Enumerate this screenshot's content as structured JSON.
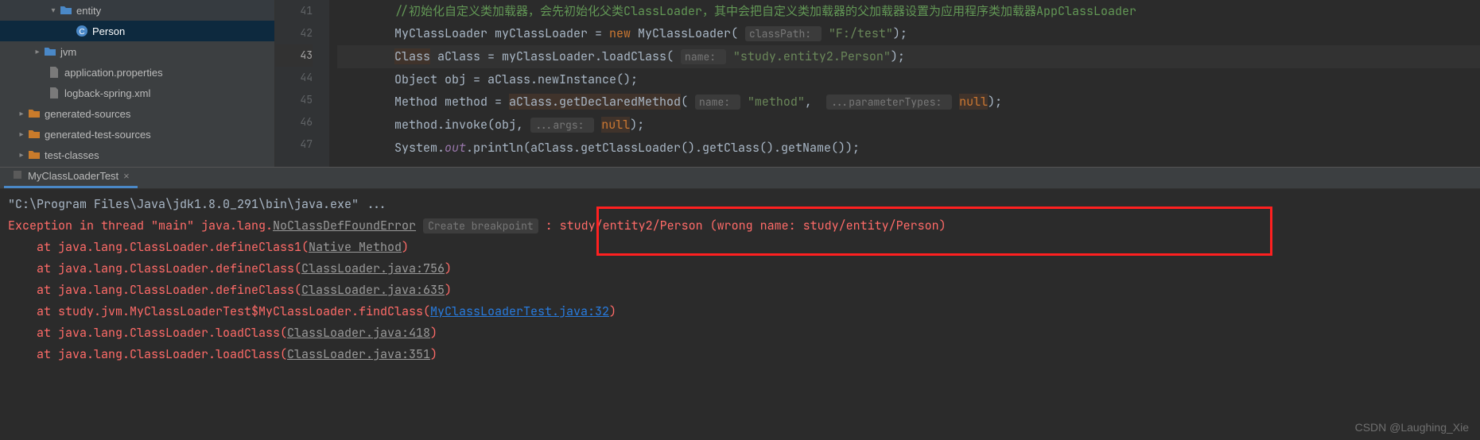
{
  "tree": {
    "items": [
      {
        "indent": 55,
        "chev": "▾",
        "icon": "folder-blue",
        "label": "entity"
      },
      {
        "indent": 75,
        "chev": "",
        "icon": "class",
        "label": "Person",
        "selected": true
      },
      {
        "indent": 35,
        "chev": "▸",
        "icon": "folder-blue",
        "label": "jvm"
      },
      {
        "indent": 40,
        "chev": "",
        "icon": "file",
        "label": "application.properties"
      },
      {
        "indent": 40,
        "chev": "",
        "icon": "file",
        "label": "logback-spring.xml"
      },
      {
        "indent": 15,
        "chev": "▸",
        "icon": "folder-orange",
        "label": "generated-sources"
      },
      {
        "indent": 15,
        "chev": "▸",
        "icon": "folder-orange",
        "label": "generated-test-sources"
      },
      {
        "indent": 15,
        "chev": "▸",
        "icon": "folder-orange",
        "label": "test-classes"
      }
    ]
  },
  "editor": {
    "lines": [
      {
        "n": 41,
        "tokens": [
          {
            "t": "        ",
            "c": ""
          },
          {
            "t": "//初始化自定义类加载器，会先初始化父类ClassLoader，其中会把自定义类加载器的父加载器设置为应用程序类加载器AppClassLoader",
            "c": "c-comment"
          }
        ]
      },
      {
        "n": 42,
        "tokens": [
          {
            "t": "        MyClassLoader myClassLoader = ",
            "c": ""
          },
          {
            "t": "new ",
            "c": "c-keyword"
          },
          {
            "t": "MyClassLoader( ",
            "c": ""
          },
          {
            "t": "classPath: ",
            "c": "c-paramhint"
          },
          {
            "t": " ",
            "c": ""
          },
          {
            "t": "\"F:/test\"",
            "c": "c-string"
          },
          {
            "t": ");",
            "c": ""
          }
        ]
      },
      {
        "n": 43,
        "cur": true,
        "tokens": [
          {
            "t": "        ",
            "c": ""
          },
          {
            "t": "Class",
            "c": "c-hl"
          },
          {
            "t": " aClass = myClassLoader.loadClass( ",
            "c": ""
          },
          {
            "t": "name: ",
            "c": "c-paramhint"
          },
          {
            "t": " ",
            "c": ""
          },
          {
            "t": "\"study.entity2.Person\"",
            "c": "c-string"
          },
          {
            "t": ");",
            "c": ""
          }
        ]
      },
      {
        "n": 44,
        "tokens": [
          {
            "t": "        Object obj = aClass.newInstance();",
            "c": ""
          }
        ]
      },
      {
        "n": 45,
        "tokens": [
          {
            "t": "        Method method = ",
            "c": ""
          },
          {
            "t": "aClass.getDeclaredMethod",
            "c": "c-hl"
          },
          {
            "t": "( ",
            "c": ""
          },
          {
            "t": "name: ",
            "c": "c-paramhint"
          },
          {
            "t": " ",
            "c": ""
          },
          {
            "t": "\"method\"",
            "c": "c-string"
          },
          {
            "t": ",  ",
            "c": ""
          },
          {
            "t": "...parameterTypes: ",
            "c": "c-paramhint"
          },
          {
            "t": " ",
            "c": ""
          },
          {
            "t": "null",
            "c": "c-keyword c-hl"
          },
          {
            "t": ");",
            "c": ""
          }
        ]
      },
      {
        "n": 46,
        "tokens": [
          {
            "t": "        method.invoke(obj, ",
            "c": ""
          },
          {
            "t": "...args: ",
            "c": "c-paramhint"
          },
          {
            "t": " ",
            "c": ""
          },
          {
            "t": "null",
            "c": "c-keyword c-hl"
          },
          {
            "t": ");",
            "c": ""
          }
        ]
      },
      {
        "n": 47,
        "tokens": [
          {
            "t": "        System.",
            "c": ""
          },
          {
            "t": "out",
            "c": "c-static"
          },
          {
            "t": ".println(aClass.getClassLoader().getClass().getName());",
            "c": ""
          }
        ]
      }
    ]
  },
  "console_tab": {
    "icon": "run-icon",
    "label": "MyClassLoaderTest",
    "close": "×"
  },
  "console": {
    "cmd": "\"C:\\Program Files\\Java\\jdk1.8.0_291\\bin\\java.exe\" ...",
    "exception_prefix": "Exception in thread \"main\" ",
    "exception_class": "java.lang.",
    "exception_link": "NoClassDefFoundError",
    "breakpoint_hint": "Create breakpoint",
    "exception_msg": " : study/entity2/Person (wrong name: study/entity/Person)",
    "stack": [
      {
        "pre": "    at java.lang.ClassLoader.defineClass1(",
        "link": "Native Method",
        "linkClass": "link-grey",
        "post": ")"
      },
      {
        "pre": "    at java.lang.ClassLoader.defineClass(",
        "link": "ClassLoader.java:756",
        "linkClass": "link-grey",
        "post": ")"
      },
      {
        "pre": "    at java.lang.ClassLoader.defineClass(",
        "link": "ClassLoader.java:635",
        "linkClass": "link-grey",
        "post": ")"
      },
      {
        "pre": "    at study.jvm.MyClassLoaderTest$MyClassLoader.findClass(",
        "link": "MyClassLoaderTest.java:32",
        "linkClass": "link-blue",
        "post": ")"
      },
      {
        "pre": "    at java.lang.ClassLoader.loadClass(",
        "link": "ClassLoader.java:418",
        "linkClass": "link-grey",
        "post": ")"
      },
      {
        "pre": "    at java.lang.ClassLoader.loadClass(",
        "link": "ClassLoader.java:351",
        "linkClass": "link-grey",
        "post": ")"
      }
    ]
  },
  "watermark": "CSDN @Laughing_Xie"
}
